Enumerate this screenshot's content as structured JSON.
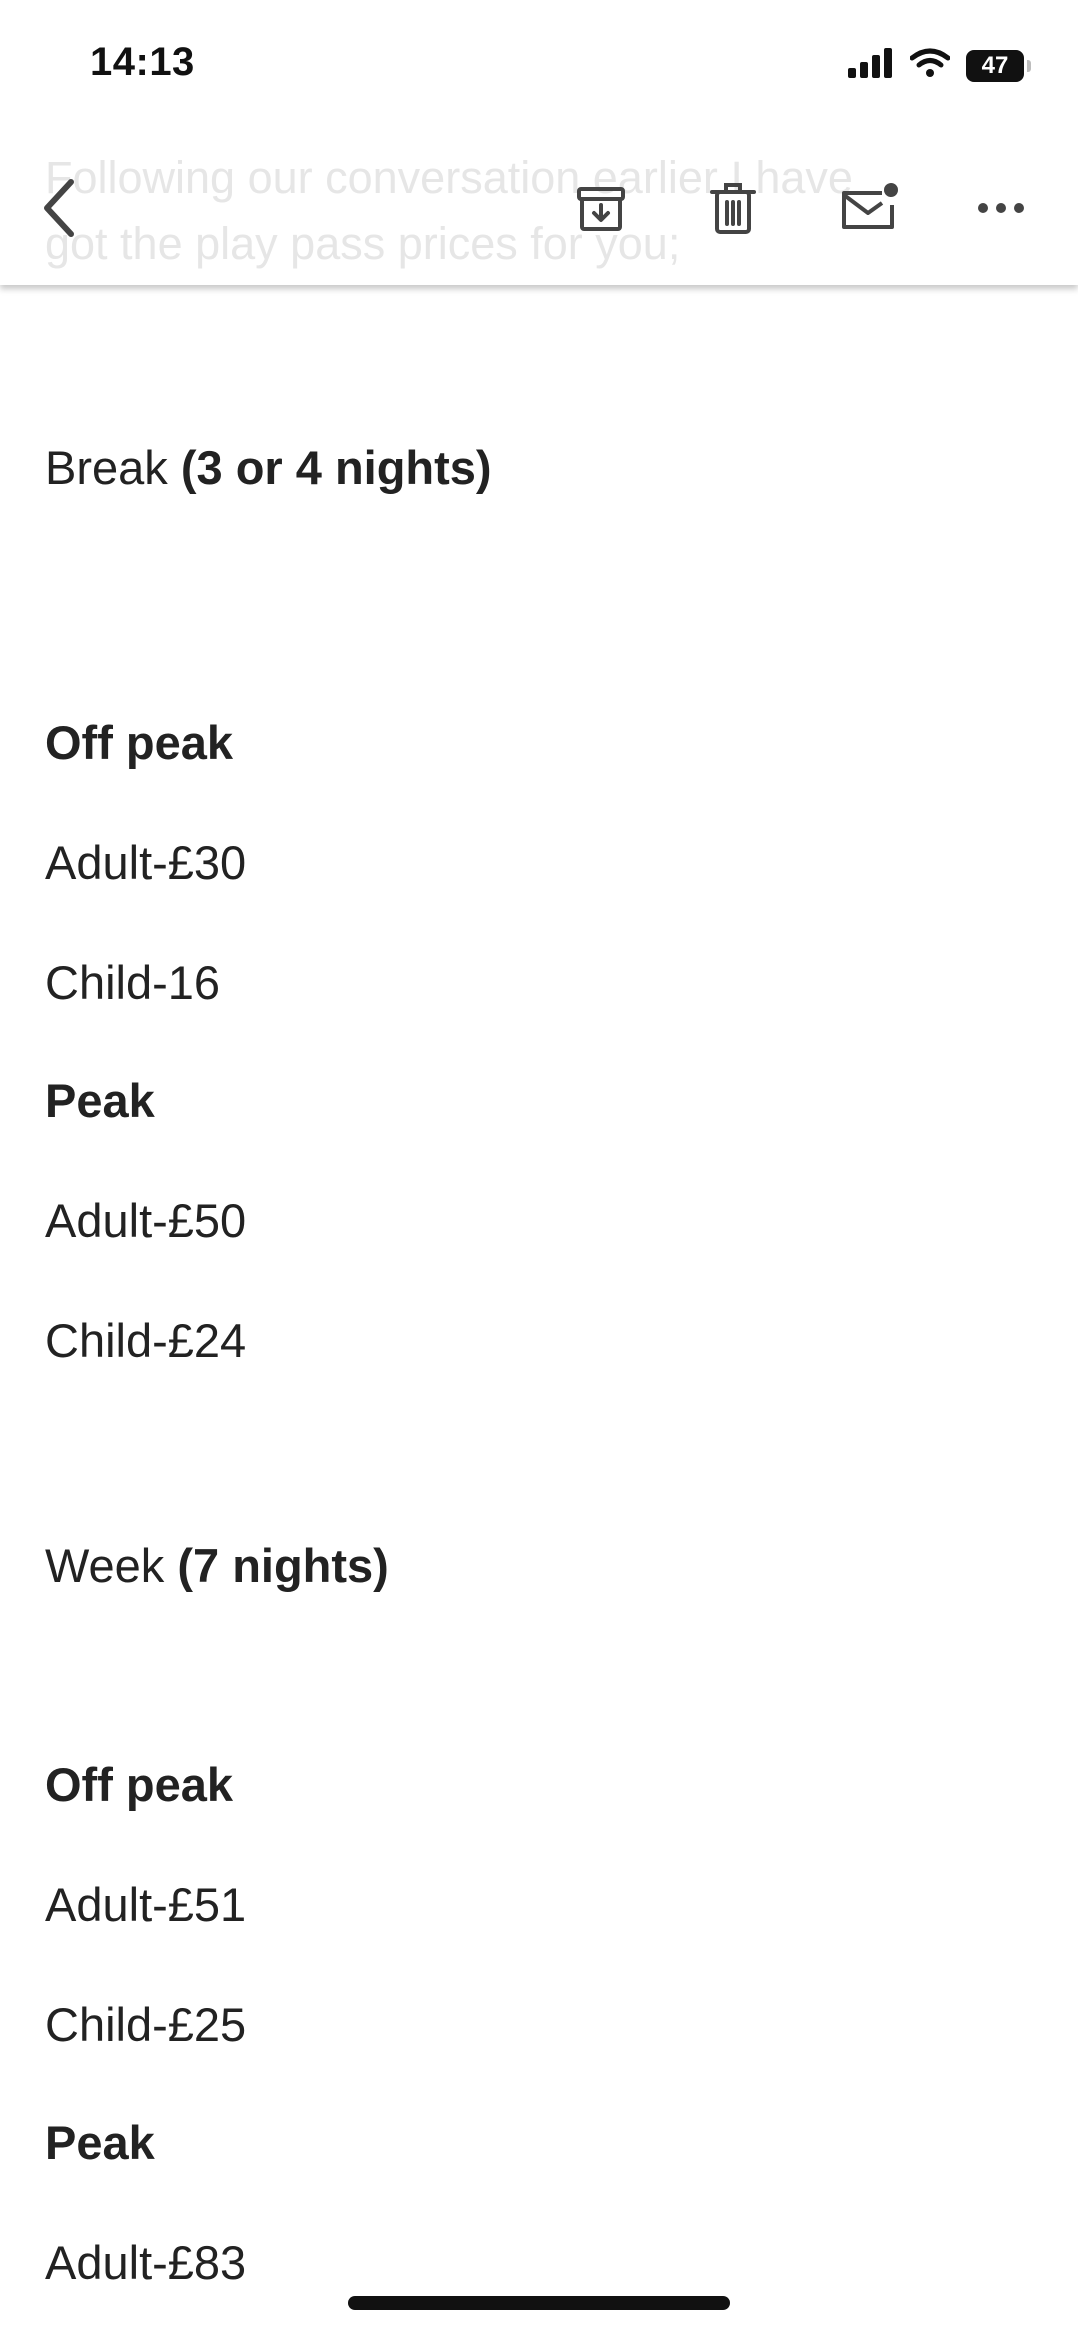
{
  "status_bar": {
    "time": "14:13",
    "battery": "47"
  },
  "toolbar": {
    "preview_line1": "Following our conversation earlier I have",
    "preview_line2": "got the play pass prices for you;",
    "icons": [
      "back-chevron-icon",
      "archive-icon",
      "delete-icon",
      "mark-unread-icon",
      "more-icon"
    ]
  },
  "email": {
    "break_label": "Break",
    "break_nights": "(3 or 4 nights)",
    "break_off_peak_heading": "Off peak",
    "break_off_peak_adult": "Adult-£30",
    "break_off_peak_child": "Child-16",
    "break_peak_heading": "Peak",
    "break_peak_adult": "Adult-£50",
    "break_peak_child": "Child-£24",
    "week_label": "Week",
    "week_nights": "(7 nights)",
    "week_off_peak_heading": "Off peak",
    "week_off_peak_adult": "Adult-£51",
    "week_off_peak_child": "Child-£25",
    "week_peak_heading": "Peak",
    "week_peak_adult": "Adult-£83"
  },
  "colors": {
    "text": "#222222",
    "faded_text": "#e6e6e6",
    "icon": "#444444"
  }
}
